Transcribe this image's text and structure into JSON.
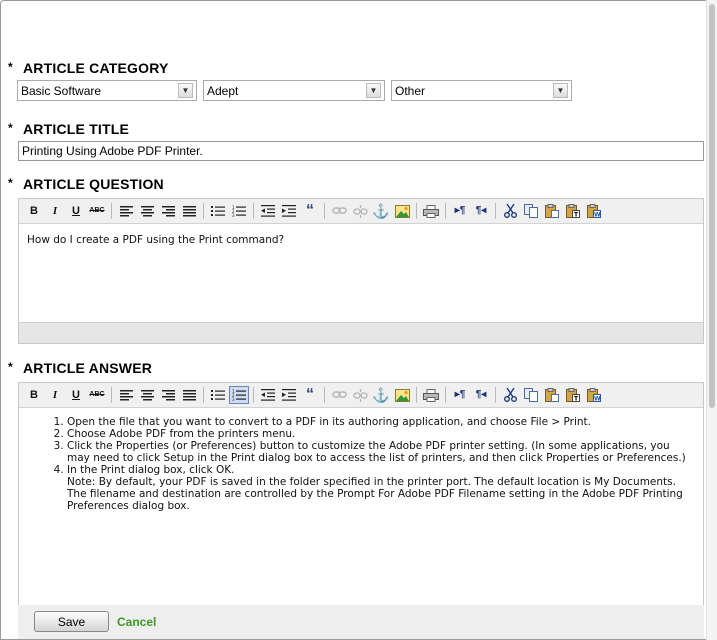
{
  "category": {
    "label": "ARTICLE CATEGORY",
    "required_mark": "*",
    "selects": [
      "Basic Software",
      "Adept",
      "Other"
    ]
  },
  "title": {
    "label": "ARTICLE TITLE",
    "required_mark": "*",
    "value": "Printing Using Adobe PDF Printer."
  },
  "question": {
    "label": "ARTICLE QUESTION",
    "required_mark": "*",
    "text": "How do I create a PDF using the Print command?"
  },
  "answer": {
    "label": "ARTICLE ANSWER",
    "required_mark": "*",
    "items": [
      "Open the file that you want to convert to a PDF in its authoring application, and choose File > Print.",
      "Choose Adobe PDF from the printers menu.",
      "Click the Properties (or Preferences) button to customize the Adobe PDF printer setting. (In some applications, you may need to click Setup in the Print dialog box to access the list of printers, and then click Properties or Preferences.)",
      "In the Print dialog box, click OK."
    ],
    "note": "Note: By default, your PDF is saved in the folder specified in the printer port. The default location is My Documents. The filename and destination are controlled by the Prompt For Adobe PDF Filename setting in the Adobe PDF Printing Preferences dialog box."
  },
  "toolbar": {
    "bold": "B",
    "italic": "I",
    "underline": "U",
    "strike": "ABC",
    "blockquote": "“",
    "ltr": "▸¶",
    "rtl": "¶◂",
    "anchor": "⚓"
  },
  "actions": {
    "save": "Save",
    "cancel": "Cancel"
  }
}
